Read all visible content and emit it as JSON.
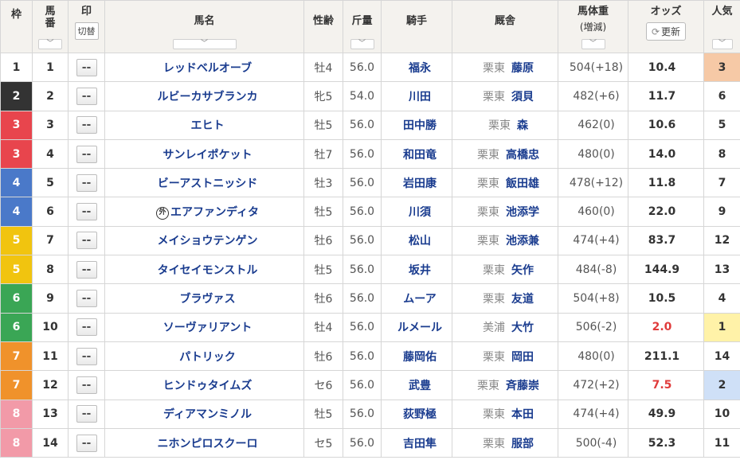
{
  "header": {
    "waku": "枠",
    "umaban_line1": "馬",
    "umaban_line2": "番",
    "mark": "印",
    "mark_toggle": "切替",
    "horse": "馬名",
    "sexage": "性齢",
    "weight": "斤量",
    "jockey": "騎手",
    "stable": "厩舎",
    "body_weight": "馬体重",
    "body_weight_sub": "(増減)",
    "odds": "オッズ",
    "refresh_icon": "⟳",
    "refresh": "更新",
    "popularity": "人気",
    "sort_glyph": "﹀"
  },
  "mark_default": "--",
  "foreign_mark": "外",
  "waku_colors": {
    "1": {
      "bg": "#ffffff",
      "fg": "#333333"
    },
    "2": {
      "bg": "#333333",
      "fg": "#ffffff"
    },
    "3": {
      "bg": "#e8454d",
      "fg": "#ffffff"
    },
    "4": {
      "bg": "#4a79c9",
      "fg": "#ffffff"
    },
    "5": {
      "bg": "#f1c40f",
      "fg": "#ffffff"
    },
    "6": {
      "bg": "#3aa655",
      "fg": "#ffffff"
    },
    "7": {
      "bg": "#f0922b",
      "fg": "#ffffff"
    },
    "8": {
      "bg": "#f29aa8",
      "fg": "#ffffff"
    }
  },
  "pop_highlight": {
    "1": "#fff2a8",
    "2": "#cfe0f7",
    "3": "#f6c9a6"
  },
  "rows": [
    {
      "waku": "1",
      "umaban": "1",
      "horse": "レッドベルオーブ",
      "foreign": false,
      "sexage": "牡4",
      "weight": "56.0",
      "jockey": "福永",
      "region": "栗東",
      "trainer": "藤原",
      "body_weight": "504(+18)",
      "odds": "10.4",
      "hot": false,
      "popularity": "3"
    },
    {
      "waku": "2",
      "umaban": "2",
      "horse": "ルビーカサブランカ",
      "foreign": false,
      "sexage": "牝5",
      "weight": "54.0",
      "jockey": "川田",
      "region": "栗東",
      "trainer": "須貝",
      "body_weight": "482(+6)",
      "odds": "11.7",
      "hot": false,
      "popularity": "6"
    },
    {
      "waku": "3",
      "umaban": "3",
      "horse": "エヒト",
      "foreign": false,
      "sexage": "牡5",
      "weight": "56.0",
      "jockey": "田中勝",
      "region": "栗東",
      "trainer": "森",
      "body_weight": "462(0)",
      "odds": "10.6",
      "hot": false,
      "popularity": "5"
    },
    {
      "waku": "3",
      "umaban": "4",
      "horse": "サンレイポケット",
      "foreign": false,
      "sexage": "牡7",
      "weight": "56.0",
      "jockey": "和田竜",
      "region": "栗東",
      "trainer": "高橋忠",
      "body_weight": "480(0)",
      "odds": "14.0",
      "hot": false,
      "popularity": "8"
    },
    {
      "waku": "4",
      "umaban": "5",
      "horse": "ビーアストニッシド",
      "foreign": false,
      "sexage": "牡3",
      "weight": "56.0",
      "jockey": "岩田康",
      "region": "栗東",
      "trainer": "飯田雄",
      "body_weight": "478(+12)",
      "odds": "11.8",
      "hot": false,
      "popularity": "7"
    },
    {
      "waku": "4",
      "umaban": "6",
      "horse": "エアファンディタ",
      "foreign": true,
      "sexage": "牡5",
      "weight": "56.0",
      "jockey": "川須",
      "region": "栗東",
      "trainer": "池添学",
      "body_weight": "460(0)",
      "odds": "22.0",
      "hot": false,
      "popularity": "9"
    },
    {
      "waku": "5",
      "umaban": "7",
      "horse": "メイショウテンゲン",
      "foreign": false,
      "sexage": "牡6",
      "weight": "56.0",
      "jockey": "松山",
      "region": "栗東",
      "trainer": "池添兼",
      "body_weight": "474(+4)",
      "odds": "83.7",
      "hot": false,
      "popularity": "12"
    },
    {
      "waku": "5",
      "umaban": "8",
      "horse": "タイセイモンストル",
      "foreign": false,
      "sexage": "牡5",
      "weight": "56.0",
      "jockey": "坂井",
      "region": "栗東",
      "trainer": "矢作",
      "body_weight": "484(-8)",
      "odds": "144.9",
      "hot": false,
      "popularity": "13"
    },
    {
      "waku": "6",
      "umaban": "9",
      "horse": "ブラヴァス",
      "foreign": false,
      "sexage": "牡6",
      "weight": "56.0",
      "jockey": "ムーア",
      "region": "栗東",
      "trainer": "友道",
      "body_weight": "504(+8)",
      "odds": "10.5",
      "hot": false,
      "popularity": "4"
    },
    {
      "waku": "6",
      "umaban": "10",
      "horse": "ソーヴァリアント",
      "foreign": false,
      "sexage": "牡4",
      "weight": "56.0",
      "jockey": "ルメール",
      "region": "美浦",
      "trainer": "大竹",
      "body_weight": "506(-2)",
      "odds": "2.0",
      "hot": true,
      "popularity": "1"
    },
    {
      "waku": "7",
      "umaban": "11",
      "horse": "パトリック",
      "foreign": false,
      "sexage": "牡6",
      "weight": "56.0",
      "jockey": "藤岡佑",
      "region": "栗東",
      "trainer": "岡田",
      "body_weight": "480(0)",
      "odds": "211.1",
      "hot": false,
      "popularity": "14"
    },
    {
      "waku": "7",
      "umaban": "12",
      "horse": "ヒンドゥタイムズ",
      "foreign": false,
      "sexage": "セ6",
      "weight": "56.0",
      "jockey": "武豊",
      "region": "栗東",
      "trainer": "斉藤崇",
      "body_weight": "472(+2)",
      "odds": "7.5",
      "hot": true,
      "popularity": "2"
    },
    {
      "waku": "8",
      "umaban": "13",
      "horse": "ディアマンミノル",
      "foreign": false,
      "sexage": "牡5",
      "weight": "56.0",
      "jockey": "荻野極",
      "region": "栗東",
      "trainer": "本田",
      "body_weight": "474(+4)",
      "odds": "49.9",
      "hot": false,
      "popularity": "10"
    },
    {
      "waku": "8",
      "umaban": "14",
      "horse": "ニホンピロスクーロ",
      "foreign": false,
      "sexage": "セ5",
      "weight": "56.0",
      "jockey": "吉田隼",
      "region": "栗東",
      "trainer": "服部",
      "body_weight": "500(-4)",
      "odds": "52.3",
      "hot": false,
      "popularity": "11"
    }
  ]
}
